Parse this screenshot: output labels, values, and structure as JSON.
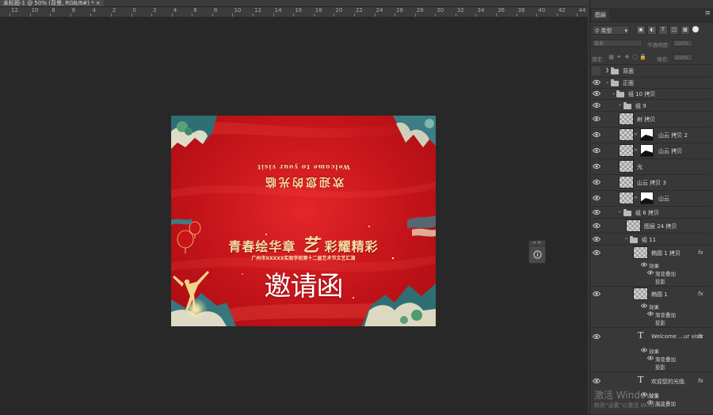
{
  "document": {
    "tab_title": "未标题-1 @ 50% (背景, RGB/8#) *",
    "tab_close": "×",
    "ruler_ticks": [
      "12",
      "10",
      "8",
      "6",
      "4",
      "2",
      "0",
      "2",
      "4",
      "6",
      "8",
      "10",
      "12",
      "14",
      "16",
      "18",
      "20",
      "22",
      "24",
      "26",
      "28",
      "30",
      "32",
      "34",
      "36",
      "38",
      "40",
      "42",
      "44"
    ]
  },
  "canvas": {
    "welcome_en": "Welcome to your visit",
    "welcome_cn": "欢迎您的光临",
    "headline_part1": "青春绘华章",
    "headline_part2": "艺",
    "headline_part3": "彩耀精彩",
    "subtitle": "广州市XXXXX实验学校第十二届艺术节文艺汇演",
    "invite": "邀请函",
    "colors": {
      "red": "#d21b20",
      "gold": "#f7dfa5"
    }
  },
  "float_panel": {
    "handle": "« ×",
    "icon": "info-icon"
  },
  "panel": {
    "tab_label": "图层",
    "filter_label": "类型",
    "blend_mode": "背景",
    "opacity_label": "不透明度:",
    "opacity_value": "100%",
    "lock_label": "锁定:",
    "fill_label": "填充:",
    "fill_value": "100%",
    "layers": [
      {
        "name": "背面"
      },
      {
        "name": "正面"
      },
      {
        "name": "组 10 拷贝"
      },
      {
        "name": "组 9"
      },
      {
        "name": "树 拷贝"
      },
      {
        "name": "山云 拷贝 2"
      },
      {
        "name": "山云 拷贝"
      },
      {
        "name": "光"
      },
      {
        "name": "山云 拷贝 3"
      },
      {
        "name": "山云"
      },
      {
        "name": "组 6 拷贝"
      },
      {
        "name": "图层 24 拷贝"
      },
      {
        "name": "组 11"
      },
      {
        "name": "椭圆 1 拷贝",
        "effects": [
          "效果",
          "渐变叠加",
          "投影"
        ]
      },
      {
        "name": "椭圆 1",
        "effects": [
          "效果",
          "渐变叠加",
          "投影"
        ]
      },
      {
        "name": "Welcome ...ur visit",
        "effects": [
          "效果",
          "渐变叠加",
          "投影"
        ]
      },
      {
        "name": "欢迎您的光临",
        "effects": [
          "效果",
          "渐变叠加"
        ]
      }
    ],
    "fx_label": "fx"
  },
  "watermark": {
    "line1": "激活 Windows",
    "line2": "转到“设置”以激活 Windows。"
  }
}
